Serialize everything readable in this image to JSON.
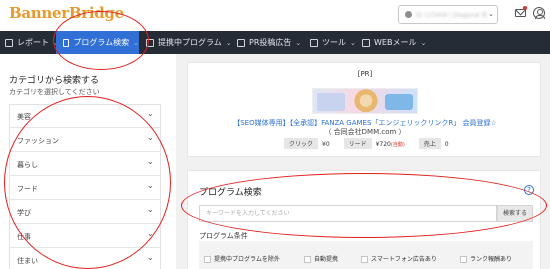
{
  "header": {
    "logo": "BannerBridge",
    "account_label": "ID 123456 | Diagonal 名前",
    "account_caret": "⌄"
  },
  "nav": {
    "items": [
      {
        "label": "レポート",
        "active": false
      },
      {
        "label": "プログラム検索",
        "active": true
      },
      {
        "label": "提携中プログラム",
        "active": false
      },
      {
        "label": "PR投稿広告",
        "active": false
      },
      {
        "label": "ツール",
        "active": false
      },
      {
        "label": "WEBメール",
        "active": false
      }
    ]
  },
  "sidebar": {
    "title": "カテゴリから検索する",
    "subtitle": "カテゴリを選択してください",
    "categories": [
      "美容",
      "ファッション",
      "暮らし",
      "フード",
      "学び",
      "仕事",
      "住まい"
    ]
  },
  "pr": {
    "title": "[PR]",
    "link": "【SEO媒体専用】【全承認】FANZA GAMES「エンジェリックリンクR」 会員登録☆",
    "company": "（ 合同会社DMM.com ）",
    "stats": [
      {
        "tag": "クリック",
        "value": "¥0"
      },
      {
        "tag": "リード",
        "value": "¥720",
        "note": "(自動)"
      },
      {
        "tag": "売上",
        "value": "0"
      }
    ]
  },
  "search": {
    "title": "プログラム検索",
    "help": "?",
    "placeholder": "キーワードを入力してください",
    "button": "検索する",
    "conditions_title": "プログラム条件",
    "conditions": [
      "提携中プログラムを除外",
      "自動提携",
      "スマートフォン広告あり",
      "ランク報酬あり"
    ]
  },
  "colors": {
    "nav_bg": "#262c36",
    "nav_active": "#2f6fd6",
    "annotation": "#e0201c",
    "link": "#2a6fd6"
  }
}
